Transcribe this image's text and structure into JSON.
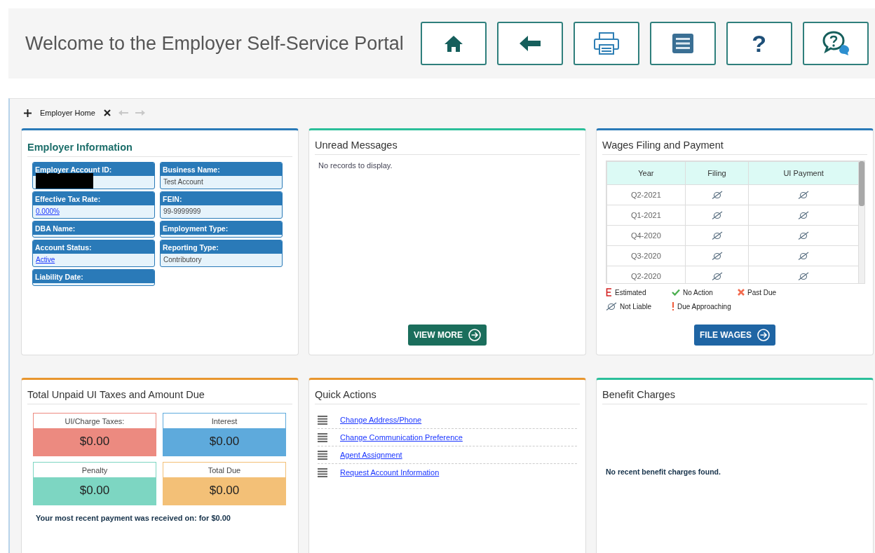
{
  "header": {
    "title": "Welcome to the Employer Self-Service Portal",
    "buttons": [
      {
        "kind": "home"
      },
      {
        "kind": "back"
      },
      {
        "kind": "print"
      },
      {
        "kind": "list"
      },
      {
        "kind": "text",
        "label": "?"
      },
      {
        "kind": "chat"
      }
    ]
  },
  "tabs": [
    {
      "label": "Employer Home",
      "selected": true
    }
  ],
  "employer_information": {
    "title": "Employer Information",
    "color": "#2a7ab8",
    "fields": [
      {
        "label": "Employer Account ID:",
        "redacted": true
      },
      {
        "label": "Business Name:",
        "value": "Test Account"
      },
      {
        "label": "Effective Tax Rate:",
        "value": "0.000%",
        "link": true
      },
      {
        "label": "FEIN:",
        "value": "99-9999999"
      },
      {
        "label": "DBA Name:"
      },
      {
        "label": "Employment Type:"
      },
      {
        "label": "Account Status:",
        "value": "Active",
        "link": true
      },
      {
        "label": "Reporting Type:",
        "value": "Contributory"
      },
      {
        "label": "Liability Date:"
      }
    ]
  },
  "unread_messages": {
    "title": "Unread Messages",
    "color": "#2bbf9a",
    "empty_text": "No records to display.",
    "button": "VIEW MORE"
  },
  "wages": {
    "title": "Wages Filing and Payment",
    "color": "#2a7ab8",
    "columns": [
      "Year",
      "Filing",
      "UI Payment"
    ],
    "rows": [
      {
        "year": "Q2-2021",
        "statuses": [
          {
            "kind": "not_liable"
          },
          {
            "kind": "not_liable"
          }
        ]
      },
      {
        "year": "Q1-2021",
        "statuses": [
          {
            "kind": "not_liable"
          },
          {
            "kind": "not_liable"
          }
        ]
      },
      {
        "year": "Q4-2020",
        "statuses": [
          {
            "kind": "not_liable"
          },
          {
            "kind": "not_liable"
          }
        ]
      },
      {
        "year": "Q3-2020",
        "statuses": [
          {
            "kind": "not_liable"
          },
          {
            "kind": "not_liable"
          }
        ]
      },
      {
        "year": "Q2-2020",
        "statuses": [
          {
            "kind": "not_liable"
          },
          {
            "kind": "not_liable"
          }
        ]
      }
    ],
    "legend": [
      {
        "kind": "estimated",
        "label": "Estimated"
      },
      {
        "kind": "no_action",
        "label": "No Action"
      },
      {
        "kind": "past_due",
        "label": "Past Due"
      },
      {
        "kind": "not_liable",
        "label": "Not Liable"
      },
      {
        "kind": "due_approaching",
        "label": "Due Approaching"
      }
    ],
    "button": "FILE WAGES"
  },
  "unpaid": {
    "title": "Total Unpaid UI Taxes and Amount Due",
    "color": "#e8962e",
    "amounts": [
      {
        "label": "UI/Charge Taxes:",
        "value": "$0.00",
        "color": "#ec8a80"
      },
      {
        "label": "Interest",
        "value": "$0.00",
        "color": "#5eaadc"
      },
      {
        "label": "Penalty",
        "value": "$0.00",
        "color": "#7dd6c2"
      },
      {
        "label": "Total Due",
        "value": "$0.00",
        "color": "#f3c077"
      }
    ],
    "note": "Your most recent payment was received on:  for $0.00"
  },
  "quick_actions": {
    "title": "Quick Actions",
    "color": "#e8962e",
    "links": [
      "Change Address/Phone",
      "Change Communication Preference",
      "Agent Assignment",
      "Request Account Information"
    ]
  },
  "benefit_charges": {
    "title": "Benefit Charges",
    "color": "#2bbf9a",
    "empty_text": "No recent benefit charges found."
  }
}
